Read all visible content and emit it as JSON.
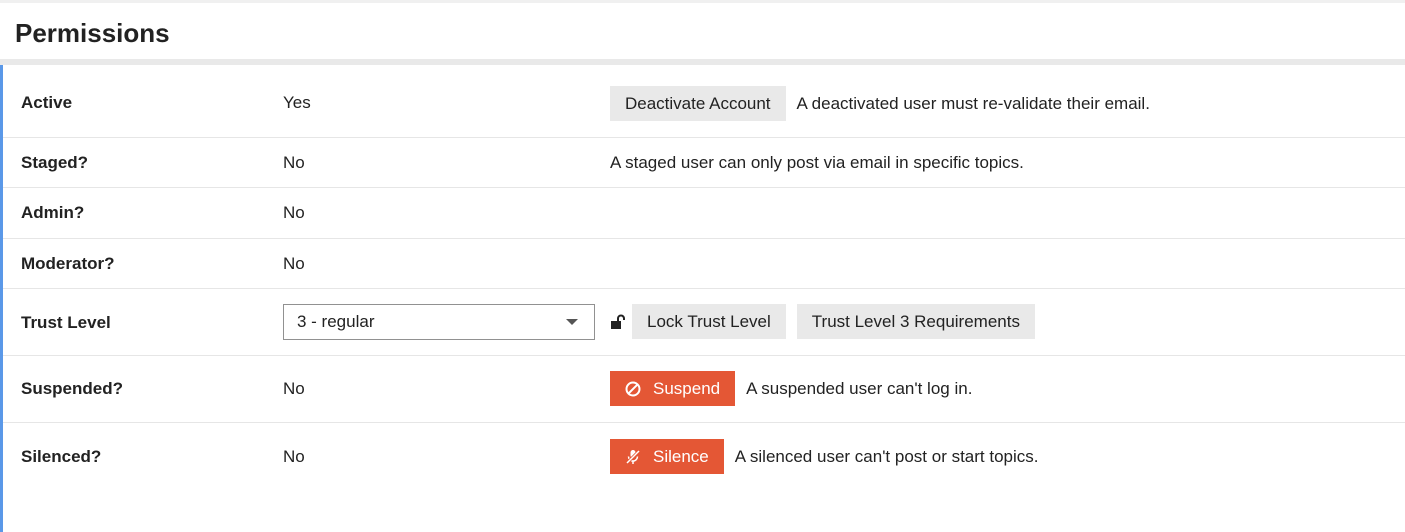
{
  "section": {
    "title": "Permissions"
  },
  "rows": {
    "active": {
      "label": "Active",
      "value": "Yes",
      "button": "Deactivate Account",
      "description": "A deactivated user must re-validate their email."
    },
    "staged": {
      "label": "Staged?",
      "value": "No",
      "description": "A staged user can only post via email in specific topics."
    },
    "admin": {
      "label": "Admin?",
      "value": "No"
    },
    "moderator": {
      "label": "Moderator?",
      "value": "No"
    },
    "trust_level": {
      "label": "Trust Level",
      "selected": "3 - regular",
      "lock_button": "Lock Trust Level",
      "requirements_button": "Trust Level 3 Requirements",
      "lock_icon": "unlock-icon"
    },
    "suspended": {
      "label": "Suspended?",
      "value": "No",
      "button": "Suspend",
      "button_icon": "ban-icon",
      "description": "A suspended user can't log in."
    },
    "silenced": {
      "label": "Silenced?",
      "value": "No",
      "button": "Silence",
      "button_icon": "microphone-slash-icon",
      "description": "A silenced user can't post or start topics."
    }
  },
  "colors": {
    "accent": "#5a98e8",
    "danger": "#e45735",
    "button_default": "#e9e9e9"
  }
}
